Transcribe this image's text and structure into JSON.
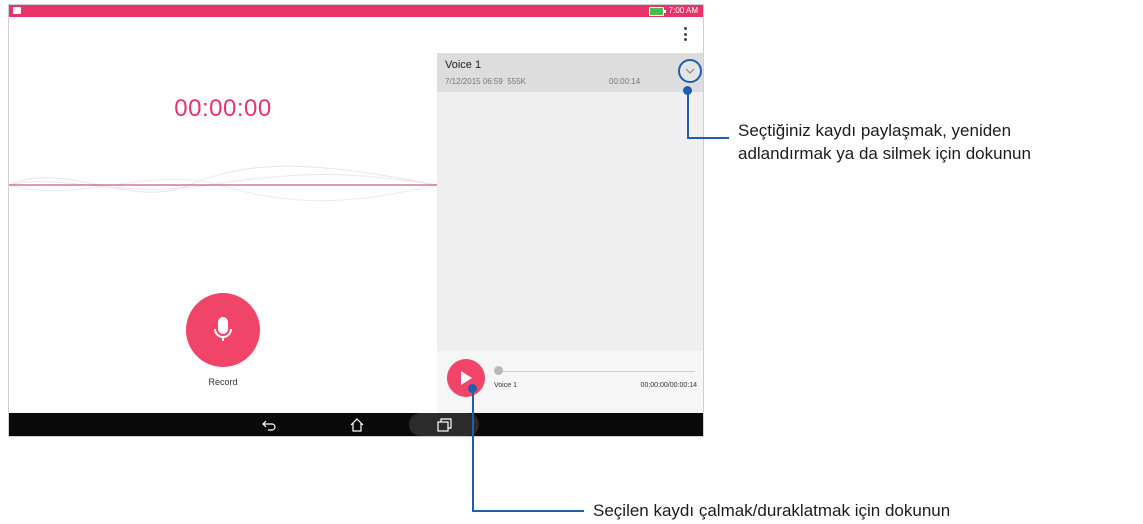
{
  "status_bar": {
    "time": "7:00 AM"
  },
  "recorder": {
    "timer": "00:00:00",
    "record_label": "Record"
  },
  "recordings": [
    {
      "name": "Voice 1",
      "date": "7/12/2015 06:59",
      "size": "555K",
      "duration": "00:00:14"
    }
  ],
  "player": {
    "track_name": "Voice 1",
    "time": "00:00:00/00:00:14",
    "progress": 0
  },
  "callouts": {
    "top_line1": "Seçtiğiniz kaydı paylaşmak, yeniden",
    "top_line2": "adlandırmak ya da silmek için dokunun",
    "bottom": "Seçilen kaydı çalmak/duraklatmak için dokunun"
  },
  "colors": {
    "accent": "#e8336a",
    "callout": "#1f5ea8"
  }
}
